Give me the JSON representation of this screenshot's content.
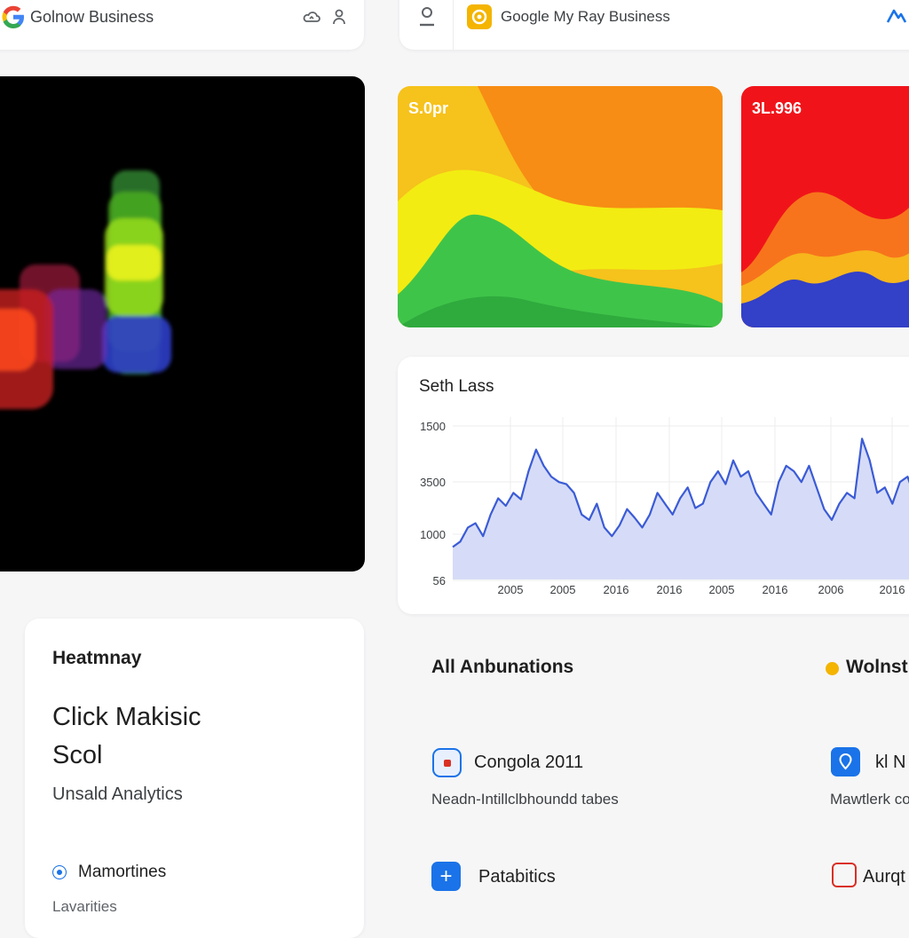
{
  "header_left": {
    "title": "Golnow Business"
  },
  "header_right": {
    "title": "Google My Ray Business"
  },
  "tiles": [
    {
      "value": "S.0pr"
    },
    {
      "value": "3L.996"
    }
  ],
  "trend_chart": {
    "title": "Seth Lass",
    "chart_data": {
      "type": "area",
      "title": "Seth Lass",
      "y_tick_labels": [
        "1500",
        "3500",
        "1000",
        "56"
      ],
      "x_tick_labels": [
        "2005",
        "2005",
        "2016",
        "2016",
        "2005",
        "2016",
        "2006",
        "2016"
      ],
      "series": [
        {
          "values": [
            600,
            650,
            780,
            820,
            700,
            900,
            1050,
            980,
            1100,
            1040,
            1300,
            1500,
            1350,
            1250,
            1200,
            1180,
            1100,
            900,
            850,
            1000,
            780,
            700,
            800,
            950,
            870,
            780,
            900,
            1100,
            1000,
            900,
            1050,
            1150,
            960,
            1000,
            1200,
            1300,
            1180,
            1400,
            1250,
            1300,
            1100,
            1000,
            900,
            1200,
            1350,
            1300,
            1200,
            1350,
            1150,
            950,
            850,
            1000,
            1100,
            1050,
            1600,
            1400,
            1100,
            1150,
            1000,
            1200,
            1250,
            1050,
            1000,
            900
          ]
        }
      ],
      "colors": {
        "line": "#3b5bd6",
        "fill": "#d6dcf7"
      }
    }
  },
  "left_panel": {
    "heading": "Heatmnay",
    "big_line1": "Click Makisic",
    "big_line2": "Scol",
    "subtitle": "Unsald Analytics",
    "item1": "Mamortines",
    "item2": "Lavarities"
  },
  "section": {
    "title": "All  Anbunations",
    "legend": "Wolnstic"
  },
  "rows": [
    {
      "title": "Congola 2011",
      "sub": "Neadn-Intillclbhoundd tabes"
    },
    {
      "title": "kl N",
      "sub": "Mawtlerk co"
    },
    {
      "title": "Patabitics"
    },
    {
      "title": "Aurqt"
    }
  ],
  "colors": {
    "accent": "#1a73e8",
    "brand_yellow": "#f4b400"
  }
}
